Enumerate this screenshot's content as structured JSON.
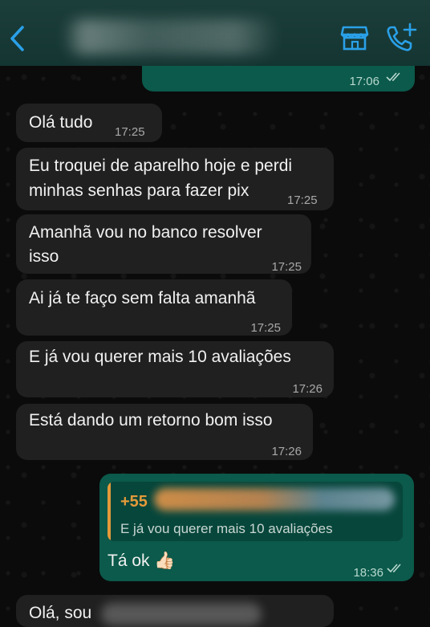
{
  "header": {
    "back_label": "<",
    "contact_name": "",
    "accent": "#2aa0e8"
  },
  "messages": [
    {
      "direction": "out",
      "text": "",
      "time": "17:06",
      "status": "read"
    },
    {
      "direction": "in",
      "lines": [
        "Olá tudo"
      ],
      "time": "17:25"
    },
    {
      "direction": "in",
      "lines": [
        "Eu troquei de aparelho hoje e perdi",
        "minhas senhas para fazer pix"
      ],
      "time": "17:25"
    },
    {
      "direction": "in",
      "lines": [
        "Amanhã vou no banco resolver",
        "isso"
      ],
      "time": "17:25"
    },
    {
      "direction": "in",
      "lines": [
        "Ai já te faço sem falta amanhã"
      ],
      "time": "17:25"
    },
    {
      "direction": "in",
      "lines": [
        "E já vou querer mais 10 avaliações"
      ],
      "time": "17:26"
    },
    {
      "direction": "in",
      "lines": [
        "Está dando um retorno bom isso"
      ],
      "time": "17:26"
    },
    {
      "direction": "out",
      "reply": {
        "sender": "+55",
        "text": "E já vou querer mais 10 avaliações"
      },
      "text": "Tá ok",
      "emoji": "👍🏻",
      "time": "18:36",
      "status": "read"
    },
    {
      "direction": "in",
      "lines": [
        "Olá, sou"
      ]
    }
  ],
  "colors": {
    "incoming_bubble": "#202020",
    "outgoing_bubble": "#0b5a4b",
    "header": "#163834",
    "reply_accent": "#e49a3a"
  }
}
